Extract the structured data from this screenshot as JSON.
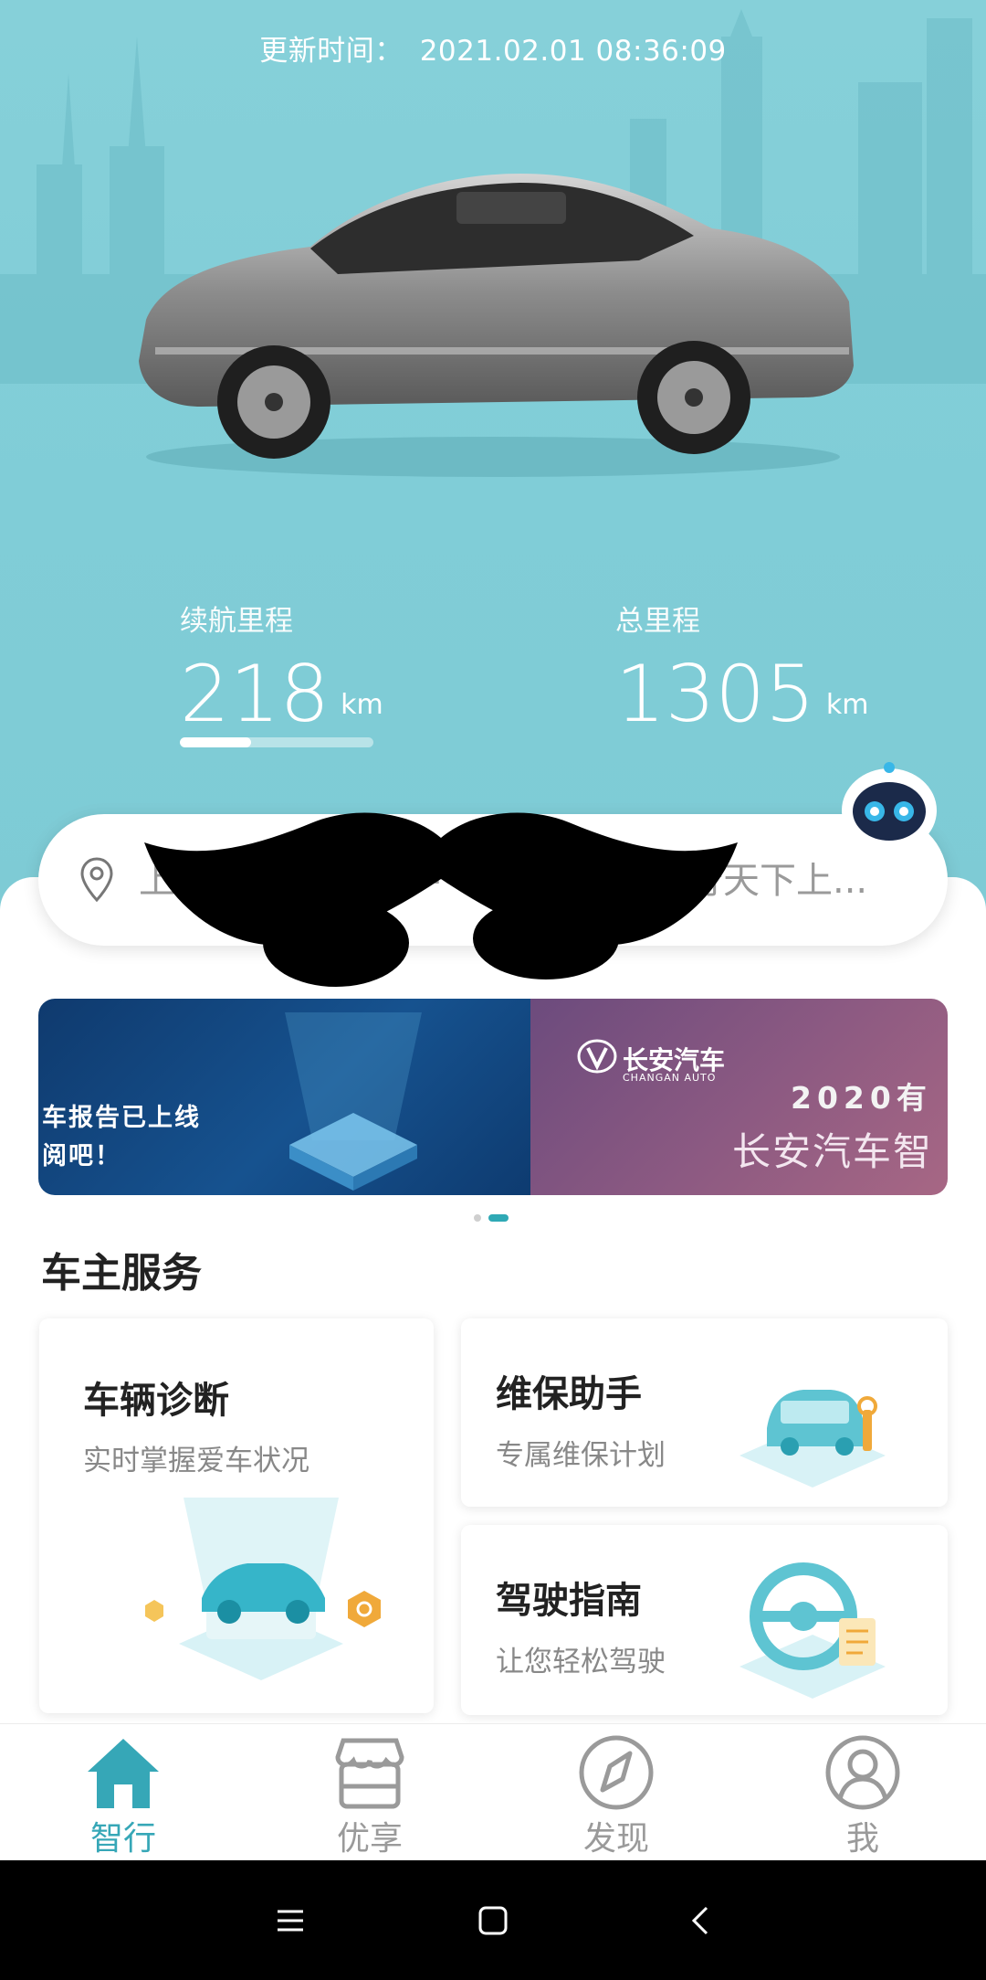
{
  "header": {
    "update_label": "更新时间：",
    "update_value": "2021.02.01 08:36:09"
  },
  "stats": {
    "range": {
      "label": "续航里程",
      "value": "218",
      "unit": "km",
      "bar_fraction": 0.37
    },
    "total": {
      "label": "总里程",
      "value": "1305",
      "unit": "km"
    }
  },
  "location": {
    "address": "上⋯⋯⋯⋯⋯⋯⋯⋯⋯⋯⋯⋯⋯⋯行天下上..."
  },
  "banner": {
    "slide1_line1": "车报告已上线",
    "slide1_line2": "阅吧！",
    "slide2_brand_cn": "长安汽车",
    "slide2_brand_en": "CHANGAN AUTO",
    "slide2_year": "2020有",
    "slide2_slogan": "长安汽车智",
    "active_dot": 1
  },
  "services": {
    "title": "车主服务",
    "diagnosis": {
      "title": "车辆诊断",
      "subtitle": "实时掌握爱车状况"
    },
    "maintenance": {
      "title": "维保助手",
      "subtitle": "专属维保计划"
    },
    "driving": {
      "title": "驾驶指南",
      "subtitle": "让您轻松驾驶"
    }
  },
  "tabs": [
    {
      "label": "智行",
      "icon": "home-icon",
      "active": true
    },
    {
      "label": "优享",
      "icon": "store-icon",
      "active": false
    },
    {
      "label": "发现",
      "icon": "compass-icon",
      "active": false
    },
    {
      "label": "我",
      "icon": "profile-icon",
      "active": false
    }
  ],
  "colors": {
    "hero": "#84cfd8",
    "accent": "#36a7b7",
    "inactive": "#9a9a9a"
  }
}
